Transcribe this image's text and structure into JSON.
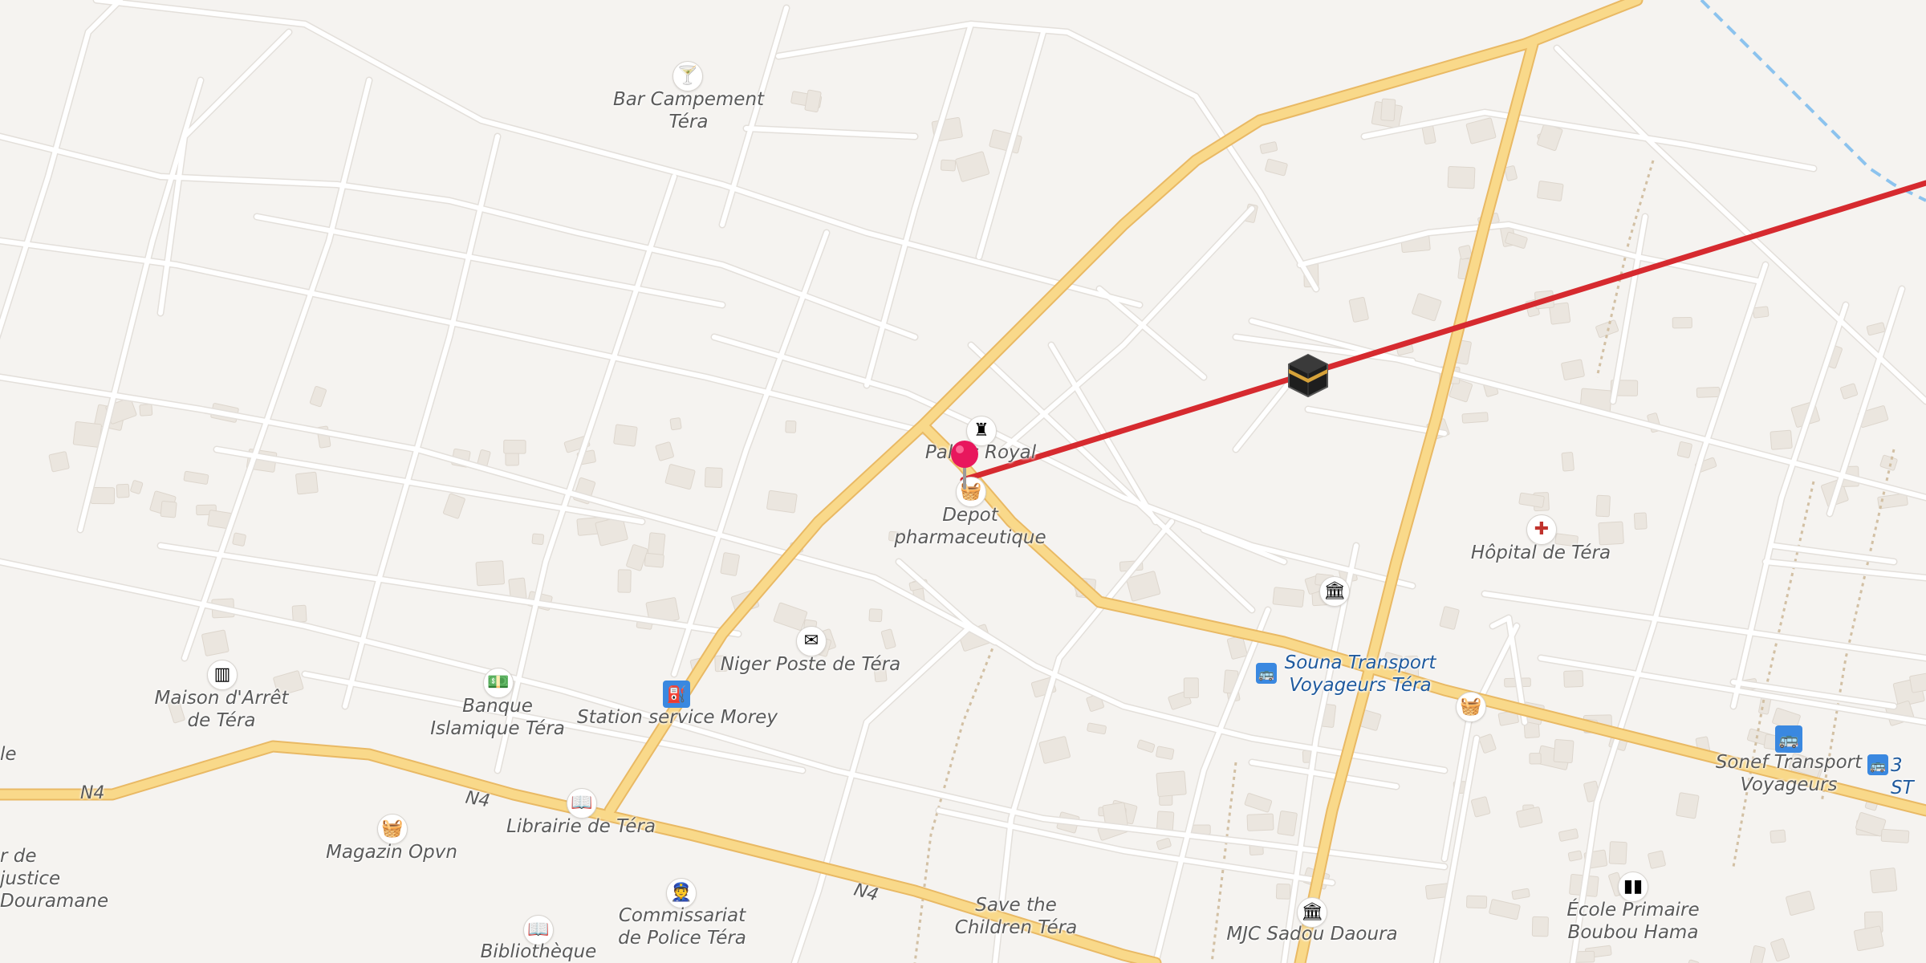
{
  "map": {
    "colors": {
      "background": "#f5f3f0",
      "minor_road": "#ffffff",
      "minor_road_casing": "#e3dfda",
      "major_road": "#f9d98a",
      "major_road_casing": "#e9b964",
      "building": "#ebe6df",
      "route_line": "#d62a2f",
      "water_line": "#8cc3ee",
      "track": "#d2c0a4"
    },
    "road_labels": [
      {
        "text": "N4"
      },
      {
        "text": "N4"
      },
      {
        "text": "N4"
      }
    ],
    "pois": [
      {
        "name": "bar",
        "icon": "cocktail-icon",
        "label": "Bar Campement\nTéra"
      },
      {
        "name": "palais",
        "icon": "castle-icon",
        "label": "Palais Royal"
      },
      {
        "name": "depot",
        "icon": "basket-icon",
        "label": "Depot\npharmaceutique"
      },
      {
        "name": "hopital",
        "icon": "red-cross-icon",
        "label": "Hôpital de Téra"
      },
      {
        "name": "museum",
        "icon": "museum-icon",
        "label": ""
      },
      {
        "name": "poste",
        "icon": "envelope-icon",
        "label": "Niger Poste de Téra"
      },
      {
        "name": "maison",
        "icon": "prison-icon",
        "label": "Maison d'Arrêt\nde Téra"
      },
      {
        "name": "banque",
        "icon": "banknote-icon",
        "label": "Banque\nIslamique Téra"
      },
      {
        "name": "station",
        "icon": "fuel-pump-icon",
        "label": "Station service Morey"
      },
      {
        "name": "souna",
        "icon": "bus-icon",
        "label": "Souna Transport\nVoyageurs Téra"
      },
      {
        "name": "shop2",
        "icon": "basket-icon",
        "label": ""
      },
      {
        "name": "sonef",
        "icon": "bus-icon",
        "label": "Sonef Transport\nVoyageurs"
      },
      {
        "name": "threest",
        "icon": "bus-icon",
        "label": "3 ST"
      },
      {
        "name": "magazin",
        "icon": "basket-icon",
        "label": "Magazin Opvn"
      },
      {
        "name": "librairie",
        "icon": "book-icon",
        "label": "Librairie de Téra"
      },
      {
        "name": "commissariat",
        "icon": "police-icon",
        "label": "Commissariat\nde Police Téra"
      },
      {
        "name": "bibliotheque",
        "icon": "book-icon",
        "label": "Bibliothèque"
      },
      {
        "name": "save",
        "icon": "",
        "label": "Save the\nChildren Téra"
      },
      {
        "name": "mjc",
        "icon": "museum-icon",
        "label": "MJC Sadou Daoura"
      },
      {
        "name": "ecole",
        "icon": "school-icon",
        "label": "École Primaire\nBoubou Hama"
      },
      {
        "name": "justice",
        "icon": "",
        "label": "r de justice\nDouramane"
      },
      {
        "name": "le",
        "icon": "",
        "label": "le"
      }
    ],
    "markers": {
      "location_pin": "map-pin-icon",
      "destination": "kaaba-icon"
    }
  }
}
